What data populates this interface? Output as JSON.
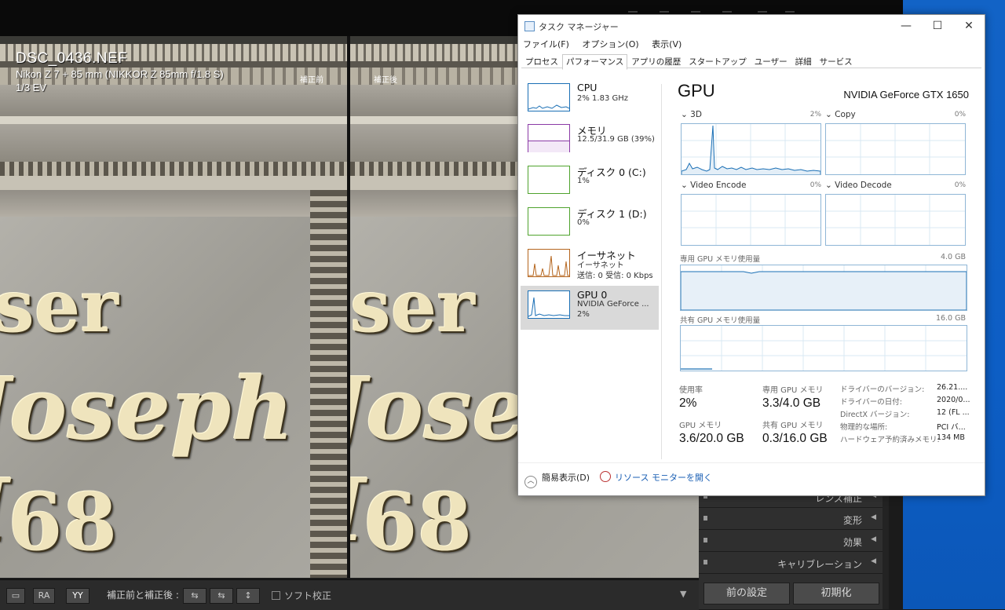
{
  "lightroom": {
    "photo_info": {
      "filename": "DSC_0436.NEF",
      "camera": "Nikon Z 7 + 85 mm (NIKKOR Z 85mm f/1.8 S)",
      "exposure": "1/3 EV"
    },
    "before_label": "補正前",
    "after_label": "補正後",
    "carving_lines": [
      "ser",
      "Joseph I",
      "68"
    ],
    "toolbar": {
      "view_btn1": "▭",
      "view_btn2": "RA",
      "view_btn3": "YY",
      "before_after_label": "補正前と補正後 :",
      "swap1": "⇆",
      "swap2": "⇆",
      "swap3": "↕",
      "soft_proof": "ソフト校正",
      "dropdown": "▼"
    },
    "right_panel": {
      "rows": [
        "レンズ補正",
        "変形",
        "効果",
        "キャリブレーション"
      ],
      "prev_button": "前の設定",
      "reset_button": "初期化"
    }
  },
  "taskmanager": {
    "title": "タスク マネージャー",
    "controls": {
      "minimize": "—",
      "maximize": "☐",
      "close": "✕"
    },
    "menu": [
      "ファイル(F)",
      "オプション(O)",
      "表示(V)"
    ],
    "tabs": [
      "プロセス",
      "パフォーマンス",
      "アプリの履歴",
      "スタートアップ",
      "ユーザー",
      "詳細",
      "サービス"
    ],
    "active_tab": "パフォーマンス",
    "sidebar": [
      {
        "name": "CPU",
        "sub1": "2%  1.83 GHz",
        "sub2": "",
        "color": "#1a6fb5"
      },
      {
        "name": "メモリ",
        "sub1": "12.5/31.9 GB (39%)",
        "sub2": "",
        "color": "#8b3aa6"
      },
      {
        "name": "ディスク 0 (C:)",
        "sub1": "1%",
        "sub2": "",
        "color": "#4fa32d"
      },
      {
        "name": "ディスク 1 (D:)",
        "sub1": "0%",
        "sub2": "",
        "color": "#4fa32d"
      },
      {
        "name": "イーサネット",
        "sub1": "イーサネット",
        "sub2": "送信: 0 受信: 0 Kbps",
        "color": "#b5651d"
      },
      {
        "name": "GPU 0",
        "sub1": "NVIDIA GeForce ...",
        "sub2": "2%",
        "color": "#1a6fb5"
      }
    ],
    "gpu": {
      "title": "GPU",
      "model": "NVIDIA GeForce GTX 1650",
      "engines": [
        {
          "label": "3D",
          "pct": "2%"
        },
        {
          "label": "Copy",
          "pct": "0%"
        },
        {
          "label": "Video Encode",
          "pct": "0%"
        },
        {
          "label": "Video Decode",
          "pct": "0%"
        }
      ],
      "dedicated_label": "専用 GPU メモリ使用量",
      "dedicated_max": "4.0 GB",
      "shared_label": "共有 GPU メモリ使用量",
      "shared_max": "16.0 GB",
      "stats": {
        "util_label": "使用率",
        "util_value": "2%",
        "ded_label": "専用 GPU メモリ",
        "ded_value": "3.3/4.0 GB",
        "gpumem_label": "GPU メモリ",
        "gpumem_value": "3.6/20.0 GB",
        "shared_label": "共有 GPU メモリ",
        "shared_value": "0.3/16.0 GB"
      },
      "info": [
        {
          "label": "ドライバーのバージョン:",
          "value": "26.21...."
        },
        {
          "label": "ドライバーの日付:",
          "value": "2020/0..."
        },
        {
          "label": "DirectX バージョン:",
          "value": "12 (FL ..."
        },
        {
          "label": "物理的な場所:",
          "value": "PCI バ..."
        },
        {
          "label": "ハードウェア予約済みメモリ:",
          "value": "134 MB"
        }
      ]
    },
    "footer": {
      "less_details": "簡易表示(D)",
      "resource_monitor": "リソース モニターを開く"
    },
    "graph_color": "#1a6fb5"
  }
}
